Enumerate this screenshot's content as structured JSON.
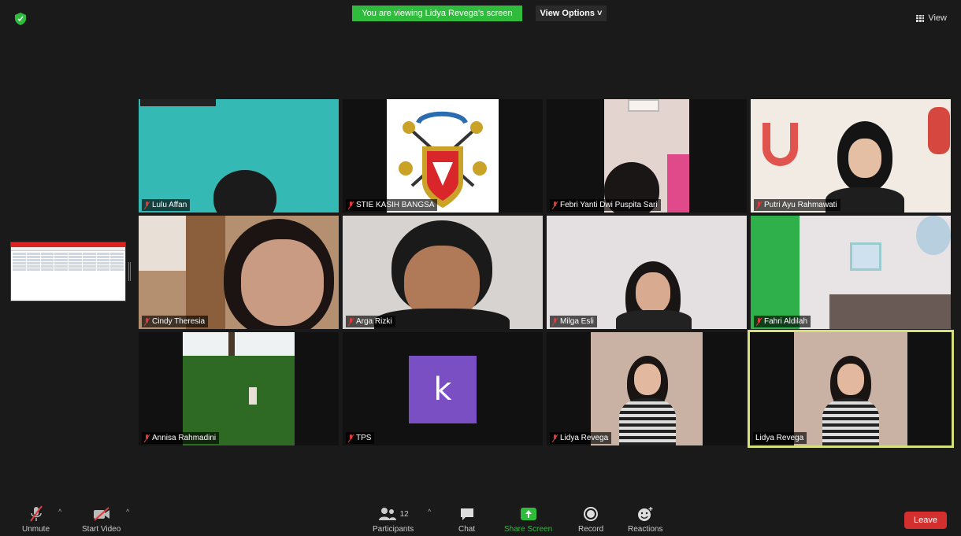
{
  "top": {
    "banner": "You are viewing Lidya Revega's screen",
    "view_options": "View Options",
    "view": "View"
  },
  "tiles": [
    {
      "name": "Lulu Affan",
      "muted": true
    },
    {
      "name": "STIE KASIH BANGSA",
      "muted": true
    },
    {
      "name": "Febri Yanti Dwi Puspita Sari",
      "muted": true
    },
    {
      "name": "Putri Ayu Rahmawati",
      "muted": true
    },
    {
      "name": "Cindy Theresia",
      "muted": true
    },
    {
      "name": "Arga Rizki",
      "muted": true
    },
    {
      "name": "Milga Esli",
      "muted": true
    },
    {
      "name": "Fahri Aldilah",
      "muted": true
    },
    {
      "name": "Annisa Rahmadini",
      "muted": true
    },
    {
      "name": "TPS",
      "muted": true,
      "avatar_letter": "k"
    },
    {
      "name": "Lidya Revega",
      "muted": true
    },
    {
      "name": "Lidya Revega",
      "muted": false,
      "active_speaker": true
    }
  ],
  "toolbar": {
    "unmute": "Unmute",
    "start_video": "Start Video",
    "participants": "Participants",
    "participants_count": "12",
    "chat": "Chat",
    "share_screen": "Share Screen",
    "record": "Record",
    "reactions": "Reactions",
    "leave": "Leave"
  },
  "colors": {
    "banner": "#2fbb3c",
    "share_screen_icon": "#2fbb3c",
    "leave": "#d32f2f",
    "active_border": "#d6e07a",
    "muted_mic": "#e03a3a",
    "tps_avatar": "#7b4fc4"
  }
}
